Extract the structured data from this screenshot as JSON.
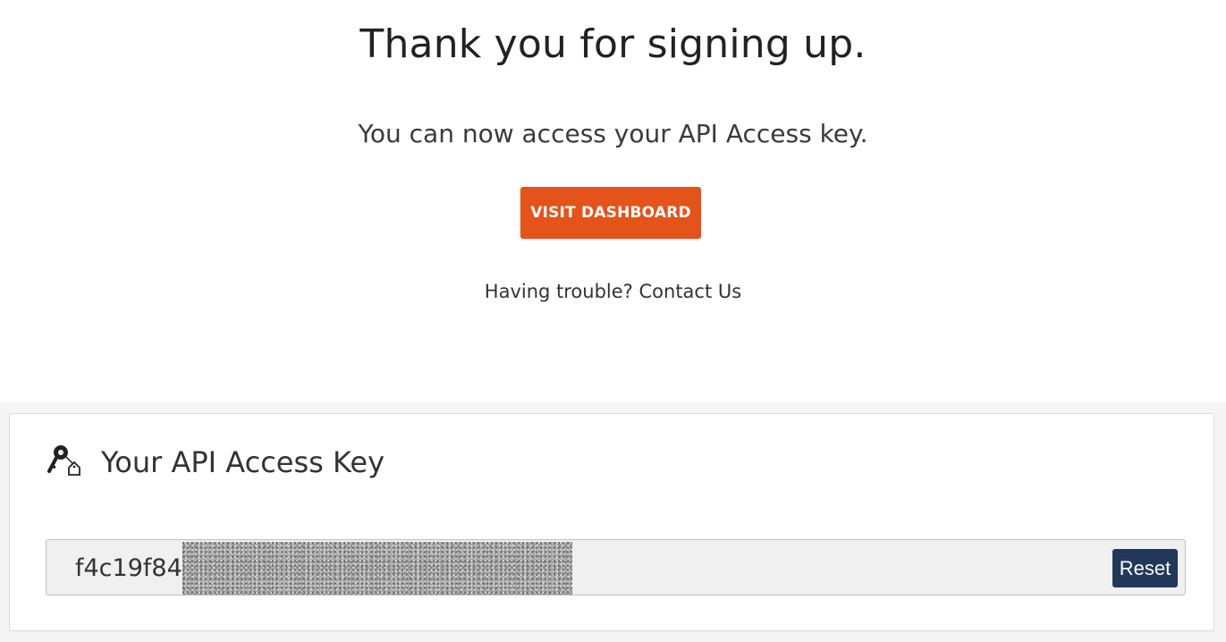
{
  "hero": {
    "title": "Thank you for signing up.",
    "subtitle": "You can now access your API Access key.",
    "cta_label": "VISIT DASHBOARD",
    "trouble_prefix": "Having trouble?",
    "contact_link": "Contact Us"
  },
  "api_key_panel": {
    "icon": "key-icon",
    "title": "Your API Access Key",
    "key_visible_prefix": "f4c19f84",
    "key_redacted": true,
    "reset_label": "Reset"
  },
  "colors": {
    "cta_bg": "#e4531a",
    "reset_bg": "#22385a",
    "band_bg": "#f5f5f5",
    "field_bg": "#f0f0f0"
  }
}
